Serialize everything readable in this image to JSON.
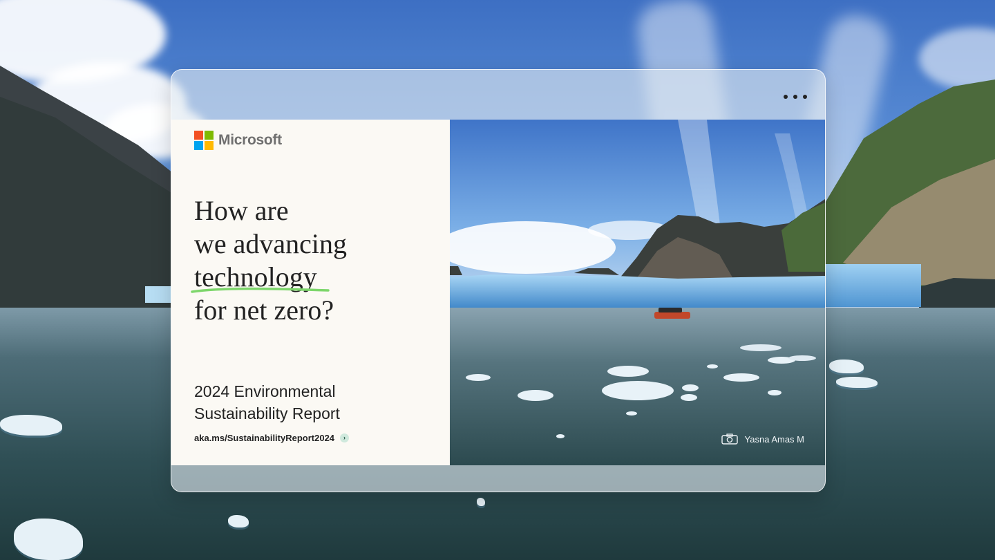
{
  "brand": {
    "name": "Microsoft",
    "logo_colors": [
      "#f25022",
      "#7fba00",
      "#00a4ef",
      "#ffb900"
    ]
  },
  "window": {
    "menu_icon": "more-horizontal-icon"
  },
  "hero": {
    "headline_lines": [
      "How are",
      "we advancing",
      "technology",
      "for net zero?"
    ],
    "highlight_color": "#7dd66b",
    "report_title_lines": [
      "2024 Environmental",
      "Sustainability Report"
    ],
    "link_text": "aka.ms/SustainabilityReport2024",
    "link_icon": "chevron-right-icon",
    "link_icon_bg": "#cfe9dd"
  },
  "photo": {
    "credit_icon": "camera-icon",
    "credit": "Yasna Amas M"
  },
  "colors": {
    "panel_bg": "#fbf9f4",
    "text": "#222222",
    "logo_text": "#6f6f6f"
  }
}
